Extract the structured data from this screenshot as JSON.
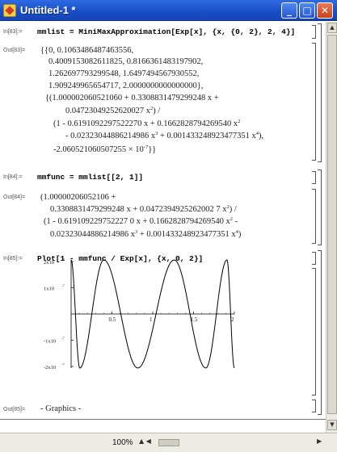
{
  "window": {
    "title": "Untitled-1 *",
    "min_glyph": "_",
    "max_glyph": "□",
    "close_glyph": "✕"
  },
  "cells": {
    "in83": {
      "label": "In[83]:=",
      "code": "mmlist = MiniMaxApproximation[Exp[x], {x, {0, 2}, 2, 4}]"
    },
    "out83": {
      "label": "Out[83]=",
      "lines": [
        "{{0, 0.1063486487463556,",
        "0.4009153082611825, 0.8166361483197902,",
        "1.262697793299548, 1.6497494567930552,",
        "1.909249965654717, 2.0000000000000000},",
        "{(1.000002060521060 + 0.3308831479299248 x +",
        "0.04723049252620027 x",
        ") /",
        "(1 - 0.6191092297522270 x + 0.1662828794269540 x",
        "- 0.02323044886214986 x",
        " + 0.001433248923477351 x",
        "),",
        "-2.060521060507255 × 10",
        "}}"
      ]
    },
    "in84": {
      "label": "In[84]:=",
      "code": "mmfunc = mmlist[[2, 1]]"
    },
    "out84": {
      "label": "Out[84]=",
      "lines": [
        "(1.00000206052106 +",
        "0.3308831479299248 x + 0.0472394925262002 7 x",
        ") /",
        "(1 - 0.619109229752227 0 x + 0.1662828794269540 x",
        " -",
        "0.02323044886214986 x",
        " + 0.001433248923477351 x",
        ")"
      ]
    },
    "in85": {
      "label": "In[85]:=",
      "code": "Plot[1 - mmfunc / Exp[x], {x, 0, 2}]"
    },
    "out85": {
      "label": "Out[85]=",
      "text": "- Graphics -"
    }
  },
  "chart_data": {
    "type": "line",
    "title": "",
    "xlabel": "",
    "ylabel": "",
    "xlim": [
      0,
      2
    ],
    "ylim": [
      -2.06e-07,
      2.06e-07
    ],
    "x_ticks": [
      "0.5",
      "1",
      "1.5",
      "2"
    ],
    "y_ticks": [
      "2x10",
      "1x10",
      "-1x10",
      "-2x10"
    ],
    "y_tick_exponent": "-7",
    "series": [
      {
        "x": [
          0,
          0.106,
          0.401,
          0.817,
          1.263,
          1.65,
          1.909,
          2.0
        ],
        "y": [
          2.06e-07,
          -2.06e-07,
          2.06e-07,
          -2.06e-07,
          2.06e-07,
          -2.06e-07,
          2.06e-07,
          -2.06e-07
        ]
      }
    ],
    "line_color": "#000000"
  },
  "status": {
    "zoom": "100%",
    "zoom_arrows": "▲ ◀",
    "right_arrow": "▶"
  },
  "scroll": {
    "up_arrow": "▲",
    "down_arrow": "▼"
  }
}
